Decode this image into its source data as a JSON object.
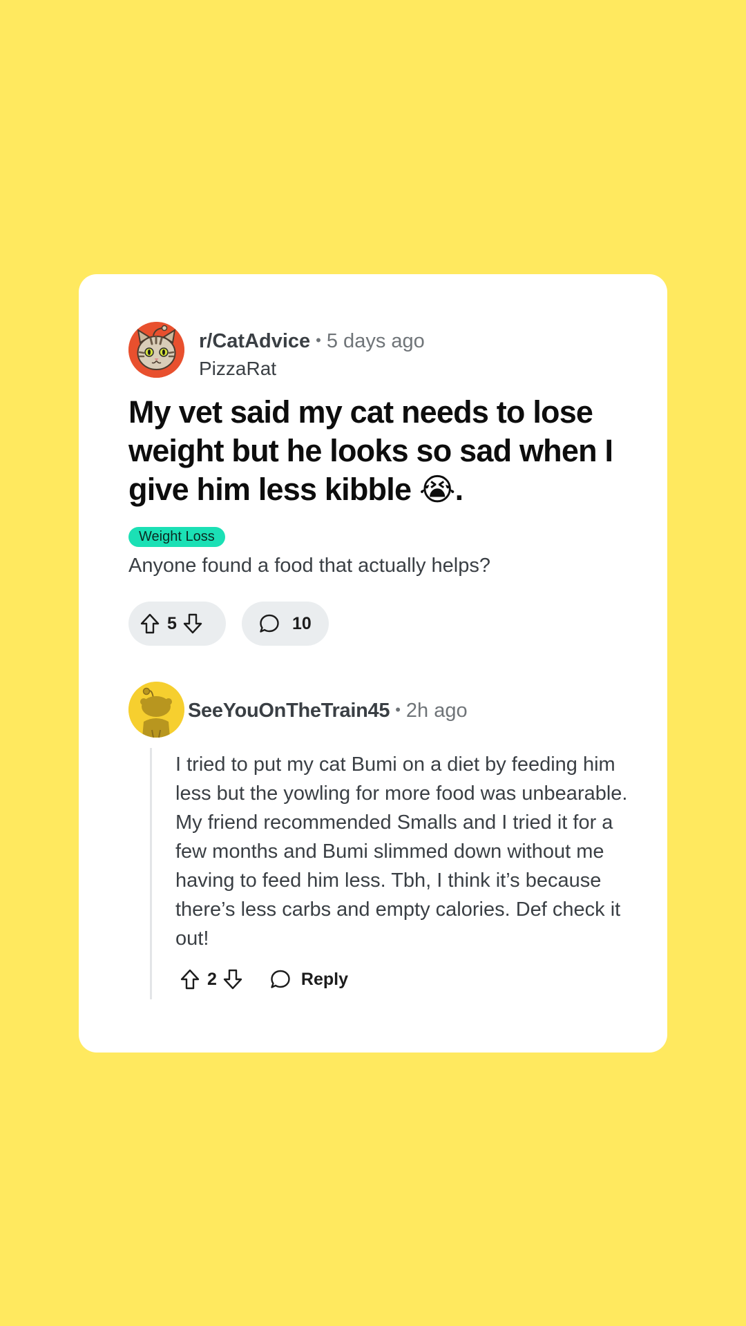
{
  "post": {
    "subreddit": "r/CatAdvice",
    "separator": "•",
    "time_ago": "5 days ago",
    "author": "PizzaRat",
    "title": "My vet said my cat needs to lose weight but he looks so sad when I give him less kibble 😭.",
    "flair": "Weight Loss",
    "body": "Anyone found a food that actually helps?",
    "score": "5",
    "comment_count": "10"
  },
  "comment": {
    "author": "SeeYouOnTheTrain45",
    "separator": "•",
    "time_ago": "2h ago",
    "body": "I tried to put my cat Bumi on a diet by feeding him less but the yowling for more food was unbearable. My friend recommended Smalls and I tried it for a few months and Bumi slimmed down without me having to feed him less. Tbh, I think it’s because there’s less carbs and empty calories. Def check it out!",
    "score": "2",
    "reply_label": "Reply"
  },
  "colors": {
    "background": "#FFE95F",
    "flair": "#1BE0B5",
    "post_avatar": "#E8502E",
    "comment_avatar": "#F6CF2F"
  },
  "icons": [
    "cat-avatar-icon",
    "upvote-icon",
    "downvote-icon",
    "comment-icon",
    "snoo-avatar-icon"
  ]
}
